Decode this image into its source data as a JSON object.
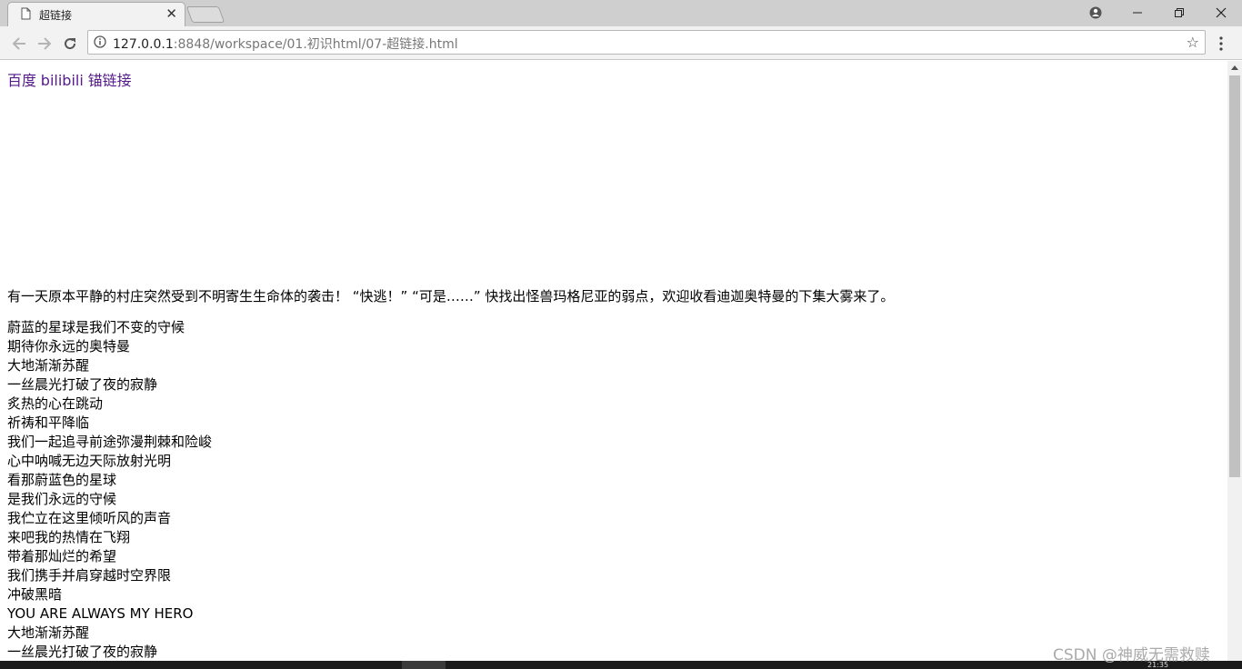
{
  "browser": {
    "tab_title": "超链接",
    "tab_close": "✕",
    "url_host": "127.0.0.1",
    "url_path": ":8848/workspace/01.初识html/07-超链接.html",
    "window_buttons": {
      "minimize": "—",
      "restore": "❐",
      "close": "✕"
    }
  },
  "page": {
    "links": [
      "百度",
      "bilibili",
      "锚链接"
    ],
    "paragraph": "有一天原本平静的村庄突然受到不明寄生生命体的袭击！ “快逃！” “可是……” 快找出怪兽玛格尼亚的弱点，欢迎收看迪迦奥特曼的下集大雾来了。",
    "lyrics": [
      "蔚蓝的星球是我们不变的守候",
      "期待你永远的奥特曼",
      "大地渐渐苏醒",
      "一丝晨光打破了夜的寂静",
      "炙热的心在跳动",
      "祈祷和平降临",
      "我们一起追寻前途弥漫荆棘和险峻",
      "心中呐喊无边天际放射光明",
      "看那蔚蓝色的星球",
      "是我们永远的守候",
      "我伫立在这里倾听风的声音",
      "来吧我的热情在飞翔",
      "带着那灿烂的希望",
      "我们携手并肩穿越时空界限",
      "冲破黑暗",
      "YOU ARE ALWAYS MY HERO",
      "大地渐渐苏醒",
      "一丝晨光打破了夜的寂静"
    ]
  },
  "taskbar": {
    "clock": "21:35"
  },
  "watermark": "CSDN @神威无需救赎"
}
